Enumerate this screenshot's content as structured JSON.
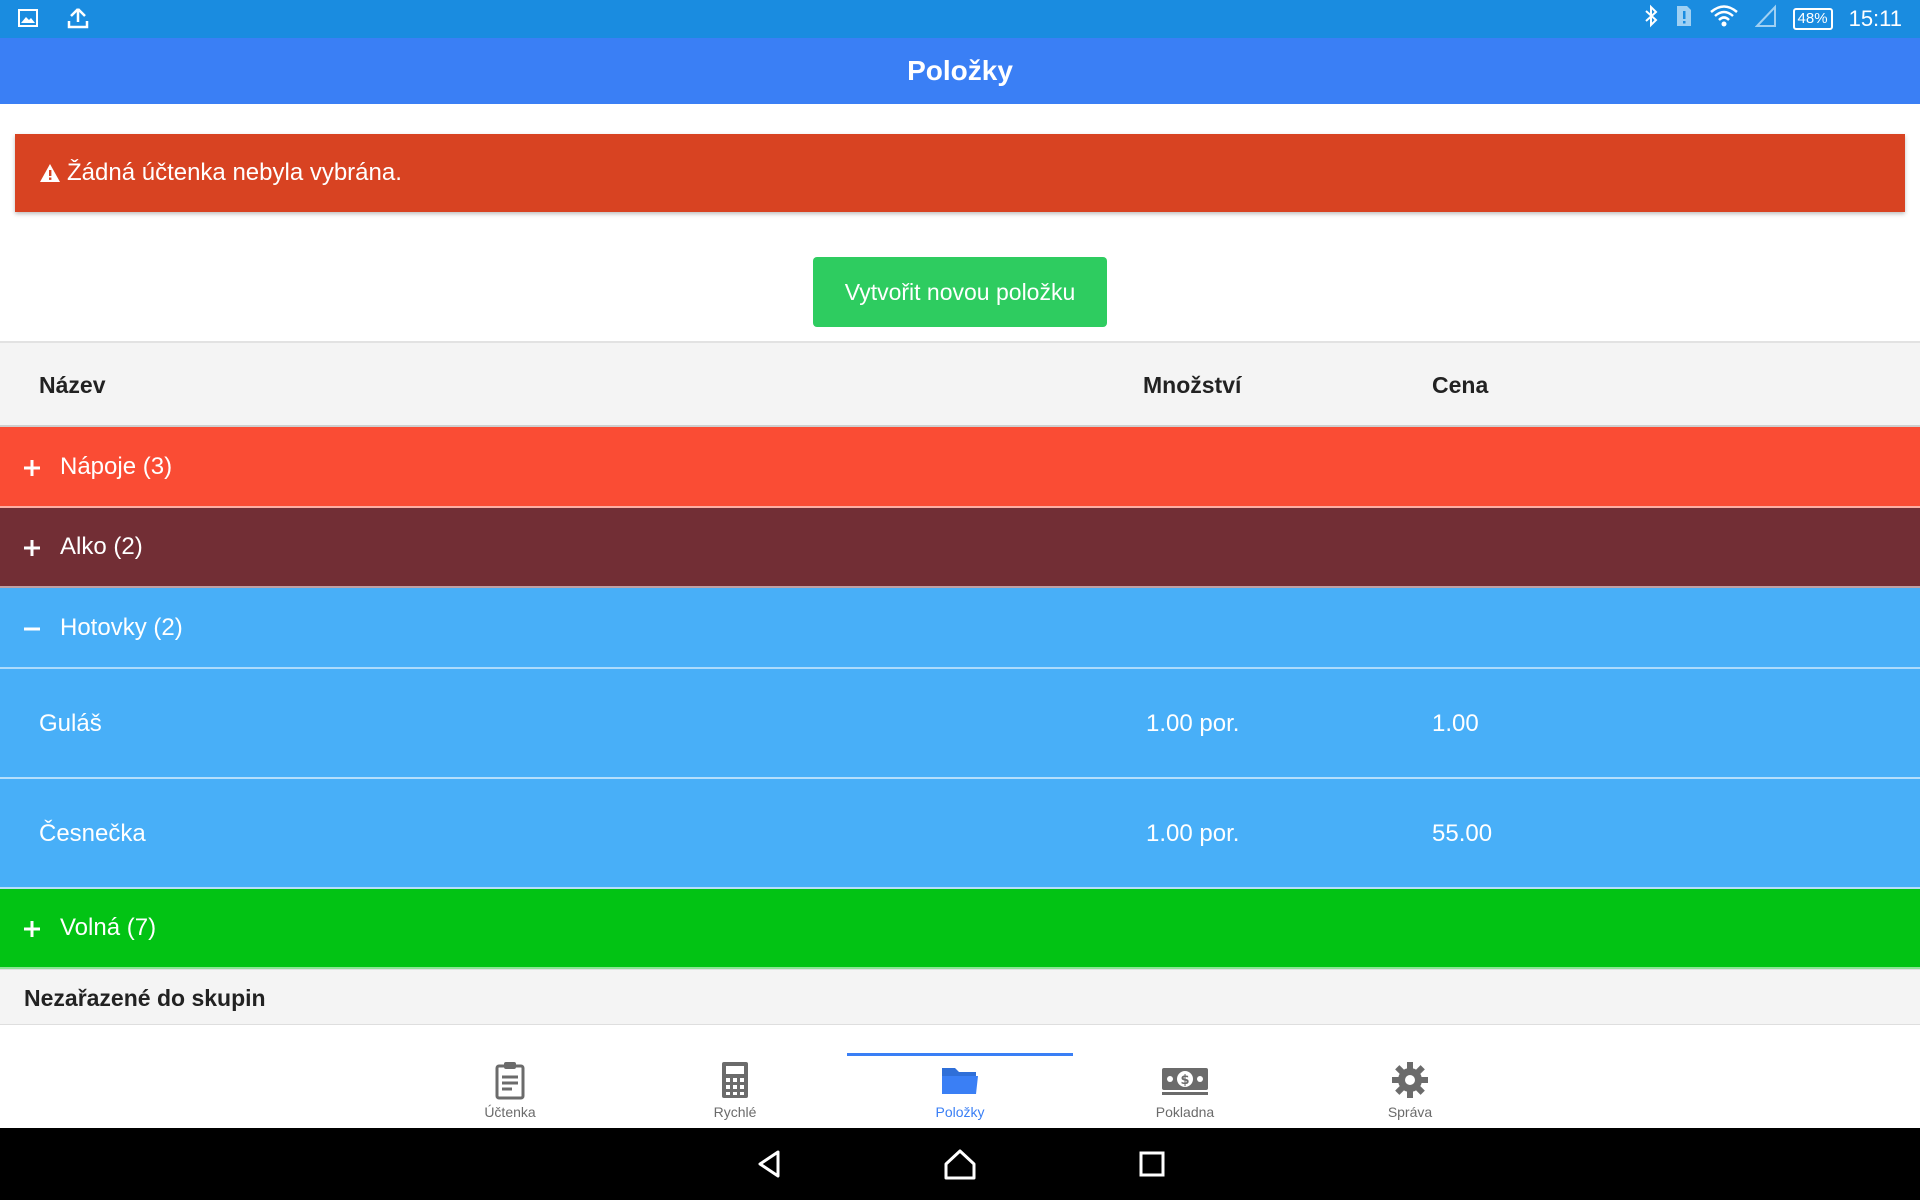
{
  "status_bar": {
    "time": "15:11",
    "battery": "48%",
    "left_icons": [
      "image-icon",
      "upload-icon"
    ],
    "right_icons": [
      "bluetooth-icon",
      "sim-alert-icon",
      "wifi-icon",
      "signal-icon",
      "battery-icon"
    ]
  },
  "app_bar": {
    "title": "Položky"
  },
  "alert": {
    "icon": "warning-icon",
    "text": "Žádná účtenka nebyla vybrána.",
    "color": "#d84322"
  },
  "create_button": {
    "label": "Vytvořit novou položku",
    "color": "#2ecc60"
  },
  "table": {
    "headers": {
      "name": "Název",
      "quantity": "Množství",
      "price": "Cena"
    },
    "groups": [
      {
        "label": "Nápoje (3)",
        "expanded": false,
        "color": "#fa4c34"
      },
      {
        "label": "Alko (2)",
        "expanded": false,
        "color": "#722e35"
      },
      {
        "label": "Hotovky (2)",
        "expanded": true,
        "color": "#48aff8",
        "items": [
          {
            "name": "Guláš",
            "quantity": "1.00 por.",
            "price": "1.00"
          },
          {
            "name": "Česnečka",
            "quantity": "1.00 por.",
            "price": "55.00"
          }
        ]
      },
      {
        "label": "Volná (7)",
        "expanded": false,
        "color": "#02c314"
      }
    ],
    "ungrouped_label": "Nezařazené do skupin"
  },
  "bottom_nav": {
    "items": [
      {
        "label": "Účtenka",
        "icon": "clipboard-icon",
        "active": false
      },
      {
        "label": "Rychlé",
        "icon": "calculator-icon",
        "active": false
      },
      {
        "label": "Položky",
        "icon": "folder-icon",
        "active": true
      },
      {
        "label": "Pokladna",
        "icon": "cash-icon",
        "active": false
      },
      {
        "label": "Správa",
        "icon": "gear-icon",
        "active": false
      }
    ],
    "accent": "#3a7ff5"
  },
  "system_nav": [
    "back-icon",
    "home-icon",
    "recents-icon"
  ]
}
